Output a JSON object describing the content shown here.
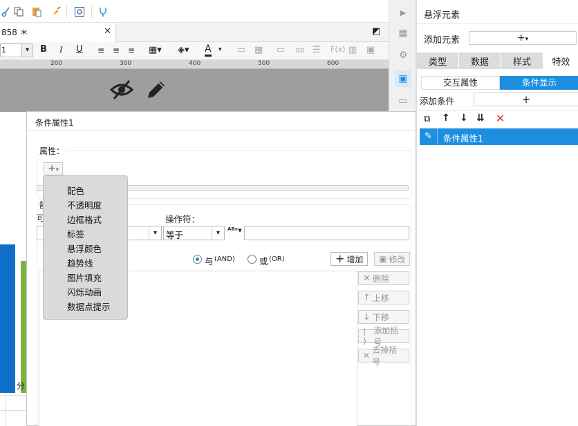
{
  "toolbar": {
    "icons": [
      "cut-icon",
      "copy-icon",
      "paste-icon",
      "format-painter-icon",
      "preview-icon",
      "plugin-icon"
    ]
  },
  "tab": {
    "label": "858 ＊",
    "close": "✕"
  },
  "format": {
    "font_size": "1",
    "bold": "B",
    "italic": "I",
    "underline": "U",
    "fx": "F(x)",
    "ab": "ab"
  },
  "ruler": {
    "ticks": [
      "200",
      "300",
      "400",
      "500",
      "600"
    ]
  },
  "canvas_icons": [
    "hide-icon",
    "edit-icon"
  ],
  "dialog": {
    "title": "条件属性1",
    "property_label": "属性：",
    "partial_labels": {
      "a": "普",
      "b": "可"
    },
    "operator_label": "操作符：",
    "operator_value": "等于",
    "and_label": "与",
    "and_code": "(AND)",
    "or_label": "或",
    "or_code": "(OR)",
    "add_label": "增加",
    "modify_label": "修改",
    "delete_label": "删除",
    "up_label": "上移",
    "down_label": "下移",
    "add_bracket_label": "添加括号",
    "remove_bracket_label": "去掉括号"
  },
  "menu": {
    "items": [
      "配色",
      "不透明度",
      "边框格式",
      "标签",
      "悬浮颜色",
      "趋势线",
      "图片填充",
      "闪烁动画",
      "数据点提示"
    ]
  },
  "panel": {
    "title": "悬浮元素",
    "add_element_label": "添加元素",
    "tabs": [
      "类型",
      "数据",
      "样式",
      "特效"
    ],
    "subtabs": [
      "交互属性",
      "条件显示"
    ],
    "add_condition_label": "添加条件",
    "list_item": "条件属性1"
  },
  "left_stub": {
    "label": "分"
  },
  "colors": {
    "accent": "#1e8fe0",
    "blue_bar": "#0f6fc6",
    "green_bar": "#7cb342"
  }
}
